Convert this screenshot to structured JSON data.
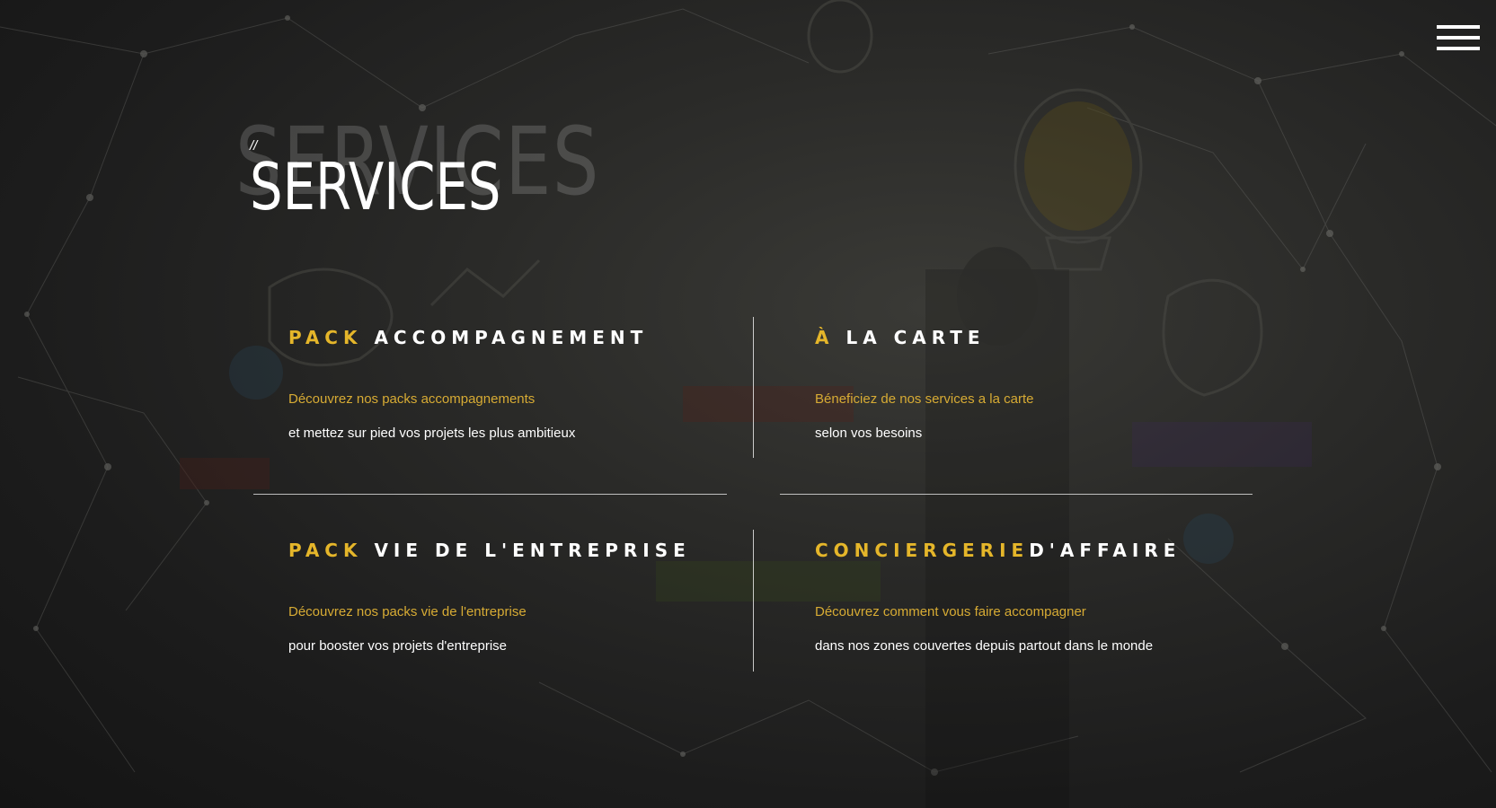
{
  "header": {
    "menu_icon": "hamburger-menu-icon",
    "ghost_title": "SERVICES",
    "slashes": "//",
    "title": "SERVICES"
  },
  "colors": {
    "accent": "#e5b62a",
    "subtitle": "#d7ab34",
    "text": "#ffffff"
  },
  "services": [
    {
      "accent": "PACK",
      "title": " ACCOMPAGNEMENT",
      "line1": "Découvrez nos packs accompagnements",
      "line2": "et mettez sur pied vos projets les plus ambitieux"
    },
    {
      "accent": "À",
      "title": " LA CARTE",
      "line1": "Béneficiez de nos services a la carte",
      "line2": "selon vos besoins"
    },
    {
      "accent": "PACK",
      "title": " VIE DE L'ENTREPRISE",
      "line1": "Découvrez nos packs vie de l'entreprise",
      "line2": "pour booster vos projets d'entreprise"
    },
    {
      "accent": "CONCIERGERIE",
      "title": "D'AFFAIRE",
      "line1": "Découvrez comment vous faire accompagner",
      "line2": "dans nos zones couvertes depuis partout dans le monde"
    }
  ]
}
